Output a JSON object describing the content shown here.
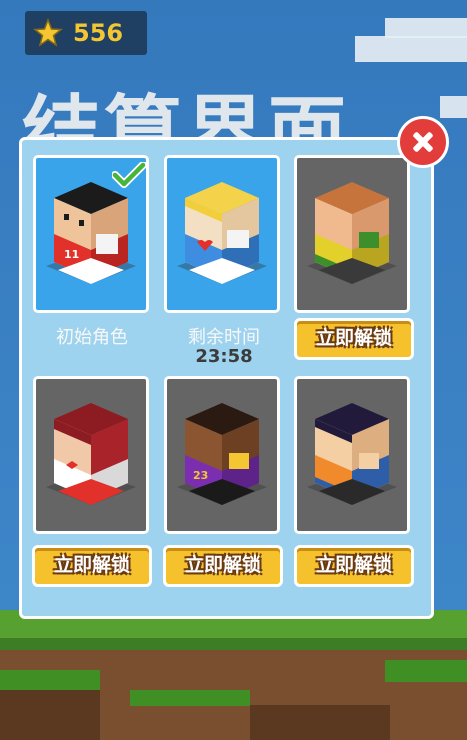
{
  "coins": {
    "count": "556",
    "icon": "star-icon",
    "color": "#f3c632"
  },
  "background": {
    "title": "结算界面",
    "side_text": ")"
  },
  "characters": [
    {
      "id": "c1",
      "label": "初始角色",
      "state": "selected",
      "shirt_number": "11",
      "selected_icon": "checkmark-icon"
    },
    {
      "id": "c2",
      "label": "剩余时间",
      "timer": "23:58",
      "state": "timed"
    },
    {
      "id": "c3",
      "button": "立即解锁",
      "state": "locked"
    },
    {
      "id": "c4",
      "button": "立即解锁",
      "state": "locked"
    },
    {
      "id": "c5",
      "button": "立即解锁",
      "state": "locked",
      "shirt_number": "23"
    },
    {
      "id": "c6",
      "button": "立即解锁",
      "state": "locked"
    }
  ],
  "close_icon": "close-icon",
  "colors": {
    "accent": "#f5c12c",
    "panel": "#9ed3ef",
    "close": "#e23d3b",
    "selected_card": "#3aa4ea",
    "locked_card": "#656565"
  }
}
